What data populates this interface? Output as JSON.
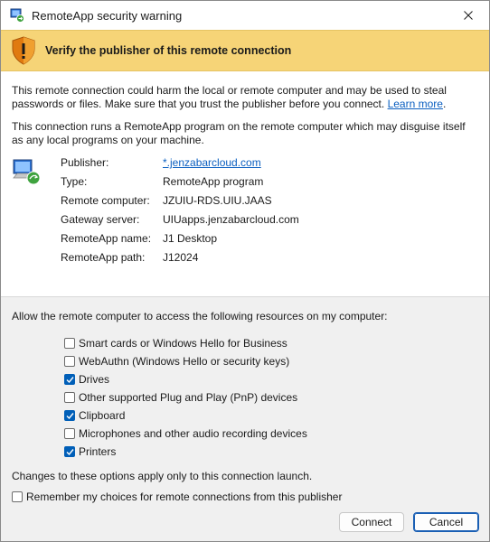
{
  "window": {
    "title": "RemoteApp security warning"
  },
  "banner": {
    "text": "Verify the publisher of this remote connection"
  },
  "intro": {
    "text": "This remote connection could harm the local or remote computer and may be used to steal passwords or files. Make sure that you trust the publisher before you connect.",
    "link": "Learn more",
    "trail": "."
  },
  "remoteapp_note": "This connection runs a RemoteApp program on the remote computer which may disguise itself as any local programs on your machine.",
  "details": [
    {
      "label": "Publisher:",
      "value": "*.jenzabarcloud.com",
      "is_link": true
    },
    {
      "label": "Type:",
      "value": "RemoteApp program"
    },
    {
      "label": "Remote computer:",
      "value": "JZUIU-RDS.UIU.JAAS"
    },
    {
      "label": "Gateway server:",
      "value": "UIUapps.jenzabarcloud.com"
    },
    {
      "label": "RemoteApp name:",
      "value": "J1 Desktop"
    },
    {
      "label": "RemoteApp path:",
      "value": "J12024"
    }
  ],
  "resources": {
    "heading": "Allow the remote computer to access the following resources on my computer:",
    "items": [
      {
        "label": "Smart cards or Windows Hello for Business",
        "checked": false
      },
      {
        "label": "WebAuthn (Windows Hello or security keys)",
        "checked": false
      },
      {
        "label": "Drives",
        "checked": true
      },
      {
        "label": "Other supported Plug and Play (PnP) devices",
        "checked": false
      },
      {
        "label": "Clipboard",
        "checked": true
      },
      {
        "label": "Microphones and other audio recording devices",
        "checked": false
      },
      {
        "label": "Printers",
        "checked": true
      }
    ],
    "note": "Changes to these options apply only to this connection launch.",
    "remember": {
      "label": "Remember my choices for remote connections from this publisher",
      "checked": false
    }
  },
  "buttons": {
    "connect": "Connect",
    "cancel": "Cancel"
  },
  "colors": {
    "banner": "#f6d477",
    "accent": "#005fb8",
    "link": "#0b5fc0"
  },
  "icons": {
    "app": "remoteapp-icon",
    "banner": "warning-shield-icon",
    "computer": "remote-computer-icon",
    "close": "close-icon"
  }
}
